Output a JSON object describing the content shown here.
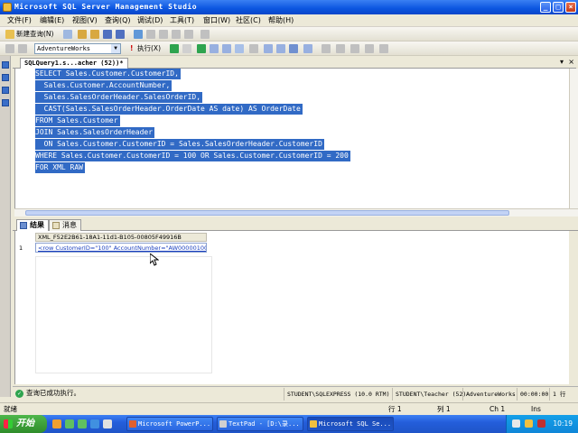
{
  "window": {
    "title": "Microsoft SQL Server Management Studio"
  },
  "menu": [
    "文件(F)",
    "编辑(E)",
    "视图(V)",
    "查询(Q)",
    "调试(D)",
    "工具(T)",
    "窗口(W)",
    "社区(C)",
    "帮助(H)"
  ],
  "toolbar": {
    "new_query": "新建查询(N)",
    "database": "AdventureWorks",
    "execute": "执行(X)"
  },
  "editor": {
    "tab_title": "SQLQuery1.s...acher (52))*",
    "code": [
      "SELECT Sales.Customer.CustomerID,",
      "  Sales.Customer.AccountNumber,",
      "  Sales.SalesOrderHeader.SalesOrderID,",
      "  CAST(Sales.SalesOrderHeader.OrderDate AS date) AS OrderDate",
      "FROM Sales.Customer",
      "JOIN Sales.SalesOrderHeader",
      "  ON Sales.Customer.CustomerID = Sales.SalesOrderHeader.CustomerID",
      "WHERE Sales.Customer.CustomerID = 100 OR Sales.Customer.CustomerID = 200",
      "FOR XML RAW"
    ]
  },
  "results": {
    "tabs": [
      "结果",
      "消息"
    ],
    "column_header": "XML_F52E2B61-18A1-11d1-B105-00805F49916B",
    "rows": [
      {
        "num": "1",
        "value": "<row CustomerID=\"100\" AccountNumber=\"AW00000100\" ..."
      }
    ]
  },
  "status": {
    "message": "查询已成功执行。",
    "server": "STUDENT\\SQLEXPRESS (10.0 RTM)",
    "user": "STUDENT\\Teacher (52)",
    "database": "AdventureWorks",
    "elapsed": "00:00:00",
    "rows": "1 行"
  },
  "app_status": {
    "ready": "就绪",
    "line": "行 1",
    "col": "列 1",
    "ch": "Ch 1",
    "ins": "Ins"
  },
  "taskbar": {
    "start": "开始",
    "tasks": [
      "Microsoft PowerP...",
      "TextPad - [D:\\录...",
      "Microsoft SQL Se..."
    ],
    "clock": "10:19"
  }
}
